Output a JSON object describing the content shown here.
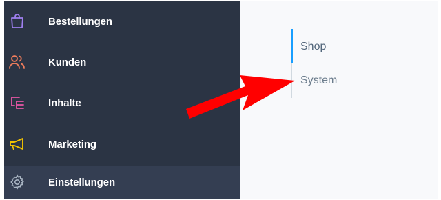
{
  "sidebar": {
    "items": [
      {
        "label": "Bestellungen",
        "icon": "shopping-bag-icon",
        "color": "#9f7ff0"
      },
      {
        "label": "Kunden",
        "icon": "users-icon",
        "color": "#f07d5c"
      },
      {
        "label": "Inhalte",
        "icon": "content-icon",
        "color": "#e957a6"
      },
      {
        "label": "Marketing",
        "icon": "megaphone-icon",
        "color": "#f2c200"
      },
      {
        "label": "Einstellungen",
        "icon": "gear-icon",
        "color": "#aab6c4"
      }
    ],
    "active": "Einstellungen"
  },
  "subnav": {
    "items": [
      {
        "label": "Shop",
        "active": true
      },
      {
        "label": "System",
        "active": false
      }
    ],
    "accent": "#189eff"
  },
  "annotation": {
    "arrow_color": "#ff0000",
    "points_to": "System"
  }
}
